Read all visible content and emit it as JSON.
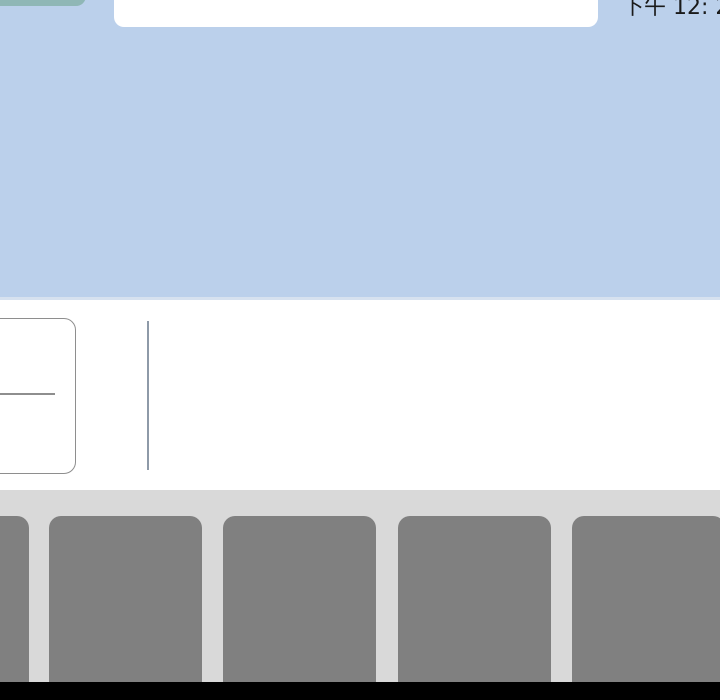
{
  "chat": {
    "message": {
      "time": "下午 12: 2"
    }
  },
  "input": {
    "text": ""
  },
  "keyboard": {
    "keys": [
      "",
      "",
      "",
      "",
      ""
    ]
  },
  "colors": {
    "chat_background": "#bbd0eb",
    "bubble": "#ffffff",
    "avatar": "#8fb7b6",
    "keyboard_background": "#d9d9d9",
    "key": "#808080",
    "navigation_bar": "#000000"
  }
}
